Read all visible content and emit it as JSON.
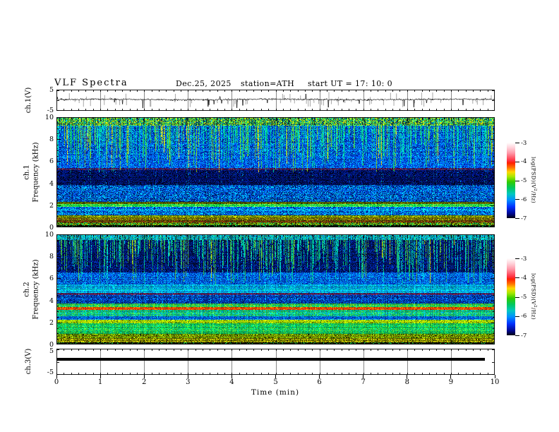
{
  "header": {
    "title": "VLF  Spectra",
    "date": "Dec.25, 2025",
    "station": "station=ATH",
    "start_ut": "start UT  =   17: 10: 0"
  },
  "time_axis": {
    "label": "Time  (min)",
    "ticks": [
      "0",
      "1",
      "2",
      "3",
      "4",
      "5",
      "6",
      "7",
      "8",
      "9",
      "10"
    ],
    "minor_per_major": 6,
    "range": [
      0,
      10
    ]
  },
  "colorbar": {
    "label_pre": "log(PSD)(V",
    "label_sup": "2",
    "label_post": "/Hz)",
    "ticks": [
      "-3",
      "-4",
      "-5",
      "-6",
      "-7"
    ],
    "values": [
      -3,
      -4,
      -5,
      -6,
      -7
    ],
    "gradient": [
      "#ffffff",
      "#ffd0d8",
      "#ff98a8",
      "#ff3040",
      "#ff2000",
      "#ff7000",
      "#ffd800",
      "#a8e800",
      "#30cc00",
      "#00c860",
      "#00c8c0",
      "#0090ff",
      "#0030ff",
      "#000890",
      "#000010"
    ],
    "gradient_stops": [
      0,
      7,
      14,
      24,
      27,
      33,
      39,
      45,
      52,
      60,
      68,
      76,
      85,
      94,
      100
    ]
  },
  "panels": {
    "ch1_wave": {
      "ylabel": "ch.1(V)",
      "yticks": [
        "5",
        "-5"
      ],
      "ytick_values": [
        5,
        -5
      ],
      "ylim": [
        -5,
        5
      ]
    },
    "ch1_spec": {
      "ylabel_ch": "ch.1",
      "ylabel_axis": "Frequency  (kHz)",
      "yticks": [
        "10",
        "8",
        "6",
        "4",
        "2",
        "0"
      ],
      "ytick_values": [
        10,
        8,
        6,
        4,
        2,
        0
      ],
      "ylim": [
        0,
        10
      ]
    },
    "ch2_spec": {
      "ylabel_ch": "ch.2",
      "ylabel_axis": "Frequency  (kHz)",
      "yticks": [
        "10",
        "8",
        "6",
        "4",
        "2",
        "0"
      ],
      "ytick_values": [
        10,
        8,
        6,
        4,
        2,
        0
      ],
      "ylim": [
        0,
        10
      ]
    },
    "ch3_wave": {
      "ylabel": "ch.3(V)",
      "yticks": [
        "5",
        "-5"
      ],
      "ytick_values": [
        5,
        -5
      ],
      "ylim": [
        -5,
        5
      ]
    }
  },
  "chart_data": [
    {
      "id": "ch1_wave",
      "type": "line",
      "color": "#000000",
      "baseline": 0.35,
      "noise_sd": 0.5,
      "spike_down_prob": 0.015,
      "spike_up_prob": 0.006,
      "gray_spikes": 70,
      "seed": 101
    },
    {
      "id": "ch1_spec",
      "type": "heatmap",
      "seed": 202,
      "flim": [
        0,
        10
      ],
      "bands": [
        {
          "from": 0.0,
          "to": 0.22,
          "colors": [
            "#000000",
            "#000000",
            "#000000",
            "#0a0a00",
            "#00b040",
            "#103010"
          ]
        },
        {
          "from": 0.22,
          "to": 0.45,
          "colors": [
            "#7a9a00",
            "#4f8f1f",
            "#1f2400",
            "#00b050",
            "#303600",
            "#86a000"
          ]
        },
        {
          "from": 0.45,
          "to": 0.65,
          "colors": [
            "#6b5d00",
            "#8a3a10",
            "#3a3c00",
            "#9a9a00",
            "#243000",
            "#703010"
          ]
        },
        {
          "from": 0.65,
          "to": 0.95,
          "colors": [
            "#8f8f00",
            "#6a6a00",
            "#7a2d10",
            "#4a5c00",
            "#b0b000",
            "#505000"
          ]
        },
        {
          "from": 0.95,
          "to": 1.15,
          "colors": [
            "#93a300",
            "#6f7c00",
            "#2e6000",
            "#aab000",
            "#506000"
          ]
        },
        {
          "from": 1.15,
          "to": 1.88,
          "colors": [
            "#0048d8",
            "#0070ff",
            "#00b4ff",
            "#00308f",
            "#00d8e8",
            "#0020a0",
            "#0090ff"
          ]
        },
        {
          "from": 1.88,
          "to": 2.12,
          "colors": [
            "#00d84a",
            "#38e868",
            "#80e040",
            "#00b438",
            "#a0f050",
            "#00c840"
          ]
        },
        {
          "from": 2.12,
          "to": 2.34,
          "colors": [
            "#5f6e00",
            "#3f4c00",
            "#8a9a00",
            "#243000",
            "#6a7a00"
          ]
        },
        {
          "from": 2.34,
          "to": 3.88,
          "colors": [
            "#0038c8",
            "#0058e8",
            "#0090ff",
            "#002488",
            "#00c8f0",
            "#001460",
            "#00a0ff",
            "#0040d0"
          ]
        },
        {
          "from": 3.88,
          "to": 5.22,
          "colors": [
            "#000c5a",
            "#001078",
            "#000430",
            "#001e96",
            "#000010",
            "#00103f",
            "#002080"
          ]
        },
        {
          "from": 5.22,
          "to": 5.42,
          "colors": [
            "#4a0040",
            "#703a5a",
            "#0030a0",
            "#200030",
            "#003090"
          ]
        },
        {
          "from": 5.42,
          "to": 6.6,
          "colors": [
            "#0038cc",
            "#0058e8",
            "#0080ff",
            "#001d90",
            "#00a8ff",
            "#0048d8"
          ]
        },
        {
          "from": 6.6,
          "to": 9.25,
          "colors": [
            "#0040cc",
            "#0068f0",
            "#0090ff",
            "#001c90",
            "#00c0f0",
            "#002ca8",
            "#0050e0"
          ]
        },
        {
          "from": 9.25,
          "to": 10.01,
          "colors": [
            "#30d048",
            "#7ae030",
            "#b8e822",
            "#00c890",
            "#e8e800",
            "#00a8e0",
            "#103060",
            "#40cc30"
          ]
        }
      ],
      "hlines": [
        {
          "f": 2.02,
          "color": "#20e050"
        },
        {
          "f": 2.3,
          "color": "#4a5500"
        },
        {
          "f": 0.52,
          "color": "#802010"
        },
        {
          "f": 0.88,
          "color": "#6a6a00"
        },
        {
          "f": 5.3,
          "color": "#5a2050"
        },
        {
          "f": 3.32,
          "color": "#0060e0"
        },
        {
          "f": 1.6,
          "color": "#00c8e8"
        },
        {
          "f": 4.4,
          "color": "#001080"
        }
      ],
      "streaks": {
        "density": 0.5,
        "depth": [
          5.0,
          8.8
        ],
        "colors": [
          "#00d070",
          "#00c896",
          "#38cc38",
          "#00e8b0",
          "#90d800"
        ],
        "rare": "#ffe000",
        "rare_prob": 0.06,
        "dark_top_prob": 0.18,
        "top_band": 9.25
      }
    },
    {
      "id": "ch2_spec",
      "type": "heatmap",
      "seed": 303,
      "flim": [
        0,
        10
      ],
      "bands": [
        {
          "from": 0.0,
          "to": 0.22,
          "colors": [
            "#000000",
            "#000000",
            "#0a0a00",
            "#00a040",
            "#101000"
          ]
        },
        {
          "from": 0.22,
          "to": 0.62,
          "colors": [
            "#a8a800",
            "#7c7c00",
            "#2e2e00",
            "#c8c800",
            "#5a6a00",
            "#909000"
          ]
        },
        {
          "from": 0.62,
          "to": 1.0,
          "colors": [
            "#8cc400",
            "#5f9e00",
            "#3a6e00",
            "#222400",
            "#a8c800",
            "#70a800"
          ]
        },
        {
          "from": 1.0,
          "to": 1.95,
          "colors": [
            "#00c455",
            "#2ed848",
            "#00a060",
            "#58d830",
            "#00c49a",
            "#20b040",
            "#00d060"
          ]
        },
        {
          "from": 1.95,
          "to": 2.3,
          "colors": [
            "#a8d800",
            "#82c400",
            "#5f6e00",
            "#c8e800",
            "#30a020",
            "#98c800"
          ]
        },
        {
          "from": 2.3,
          "to": 2.62,
          "colors": [
            "#0054d8",
            "#0084ff",
            "#00389e",
            "#00a8e8",
            "#0068e8"
          ]
        },
        {
          "from": 2.62,
          "to": 3.18,
          "colors": [
            "#00b468",
            "#00c4a4",
            "#2ec448",
            "#00a0e0",
            "#48d060",
            "#00b880"
          ]
        },
        {
          "from": 3.18,
          "to": 3.44,
          "colors": [
            "#e83000",
            "#ff6600",
            "#c42000",
            "#ff9e00",
            "#a05000",
            "#ff5000"
          ]
        },
        {
          "from": 3.44,
          "to": 3.76,
          "colors": [
            "#00c448",
            "#50c428",
            "#00b088",
            "#80cc20",
            "#20c060"
          ]
        },
        {
          "from": 3.76,
          "to": 4.55,
          "colors": [
            "#0034b4",
            "#0054d8",
            "#00248a",
            "#0090ff",
            "#001a60",
            "#0040c0"
          ]
        },
        {
          "from": 4.55,
          "to": 4.74,
          "colors": [
            "#5a1c3c",
            "#7c3050",
            "#0030a0",
            "#30103a",
            "#004090"
          ]
        },
        {
          "from": 4.74,
          "to": 5.5,
          "colors": [
            "#00a4d8",
            "#00c4f0",
            "#0084e4",
            "#00d8c8",
            "#0068d0",
            "#00b4e8"
          ]
        },
        {
          "from": 5.5,
          "to": 6.6,
          "colors": [
            "#0044c8",
            "#0070e8",
            "#002296",
            "#00a0f0",
            "#0058d8"
          ]
        },
        {
          "from": 6.6,
          "to": 9.5,
          "colors": [
            "#001060",
            "#000c40",
            "#002090",
            "#000618",
            "#0030b0",
            "#001878",
            "#001468"
          ]
        },
        {
          "from": 9.5,
          "to": 10.01,
          "colors": [
            "#00c4b4",
            "#00d8e8",
            "#30c464",
            "#00a0f0",
            "#207090",
            "#00b8d0"
          ]
        }
      ],
      "hlines": [
        {
          "f": 3.3,
          "color": "#ff4400"
        },
        {
          "f": 4.64,
          "color": "#702045"
        },
        {
          "f": 2.12,
          "color": "#b8d800"
        },
        {
          "f": 0.74,
          "color": "#8a8a00"
        },
        {
          "f": 0.55,
          "color": "#5a5a00"
        },
        {
          "f": 1.32,
          "color": "#30c050"
        },
        {
          "f": 5.02,
          "color": "#00d8d0"
        },
        {
          "f": 2.46,
          "color": "#0040b0"
        }
      ],
      "streaks": {
        "density": 0.45,
        "depth": [
          5.5,
          9.2
        ],
        "colors": [
          "#00c878",
          "#00d8a8",
          "#30c848",
          "#00e8c8",
          "#60c830"
        ],
        "rare": "#d8e800",
        "rare_prob": 0.05,
        "dark_top_prob": 0.3,
        "top_band": 9.5
      }
    },
    {
      "id": "ch3_wave",
      "type": "line",
      "color": "#000000",
      "value": 0.9,
      "thickness": 4,
      "t_end": 9.78,
      "seed": 404
    }
  ]
}
